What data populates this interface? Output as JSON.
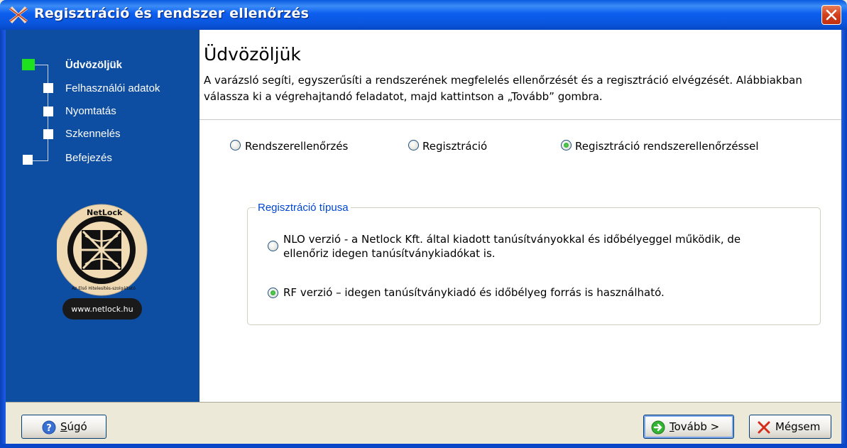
{
  "window": {
    "title": "Regisztráció és rendszer ellenőrzés"
  },
  "sidebar": {
    "steps": [
      {
        "label": "Üdvözöljük",
        "active": true
      },
      {
        "label": "Felhasználói adatok",
        "active": false
      },
      {
        "label": "Nyomtatás",
        "active": false
      },
      {
        "label": "Szkennelés",
        "active": false
      },
      {
        "label": "Befejezés",
        "active": false
      }
    ],
    "logo": {
      "ring_top": "NetLock",
      "ring_bottom": "Az Első Hitelesítés-szolgáltató",
      "url": "www.netlock.hu"
    }
  },
  "main": {
    "title": "Üdvözöljük",
    "intro": "A varázsló segíti, egyszerűsíti a rendszerének megfelelés ellenőrzését és a regisztráció elvégzését. Alábbiakban válassza ki a végrehajtandó feladatot, majd kattintson a „Tovább” gombra.",
    "task_options": [
      {
        "label": "Rendszerellenőrzés",
        "selected": false
      },
      {
        "label": "Regisztráció",
        "selected": false
      },
      {
        "label": "Regisztráció rendszerellenőrzéssel",
        "selected": true
      }
    ],
    "reg_type": {
      "legend": "Regisztráció típusa",
      "options": [
        {
          "line1": "NLO verzió - a Netlock Kft. által kiadott tanúsítványokkal és időbélyeggel működik, de",
          "line2": "ellenőriz idegen tanúsítványkiadókat is.",
          "selected": false
        },
        {
          "line1": "RF verzió – idegen tanúsítványkiadó és időbélyeg forrás is használható.",
          "selected": true
        }
      ]
    }
  },
  "footer": {
    "help_button": {
      "underline": "S",
      "rest": "úgó"
    },
    "next_button": {
      "underline": "T",
      "rest": "ovább >"
    },
    "cancel_button": {
      "label": "Mégsem"
    }
  },
  "colors": {
    "titlebar": "#0a55dc",
    "sidebar": "#0d4ea2",
    "active_step": "#1fe21f",
    "legend": "#0046d5",
    "background": "#ece9d8"
  }
}
